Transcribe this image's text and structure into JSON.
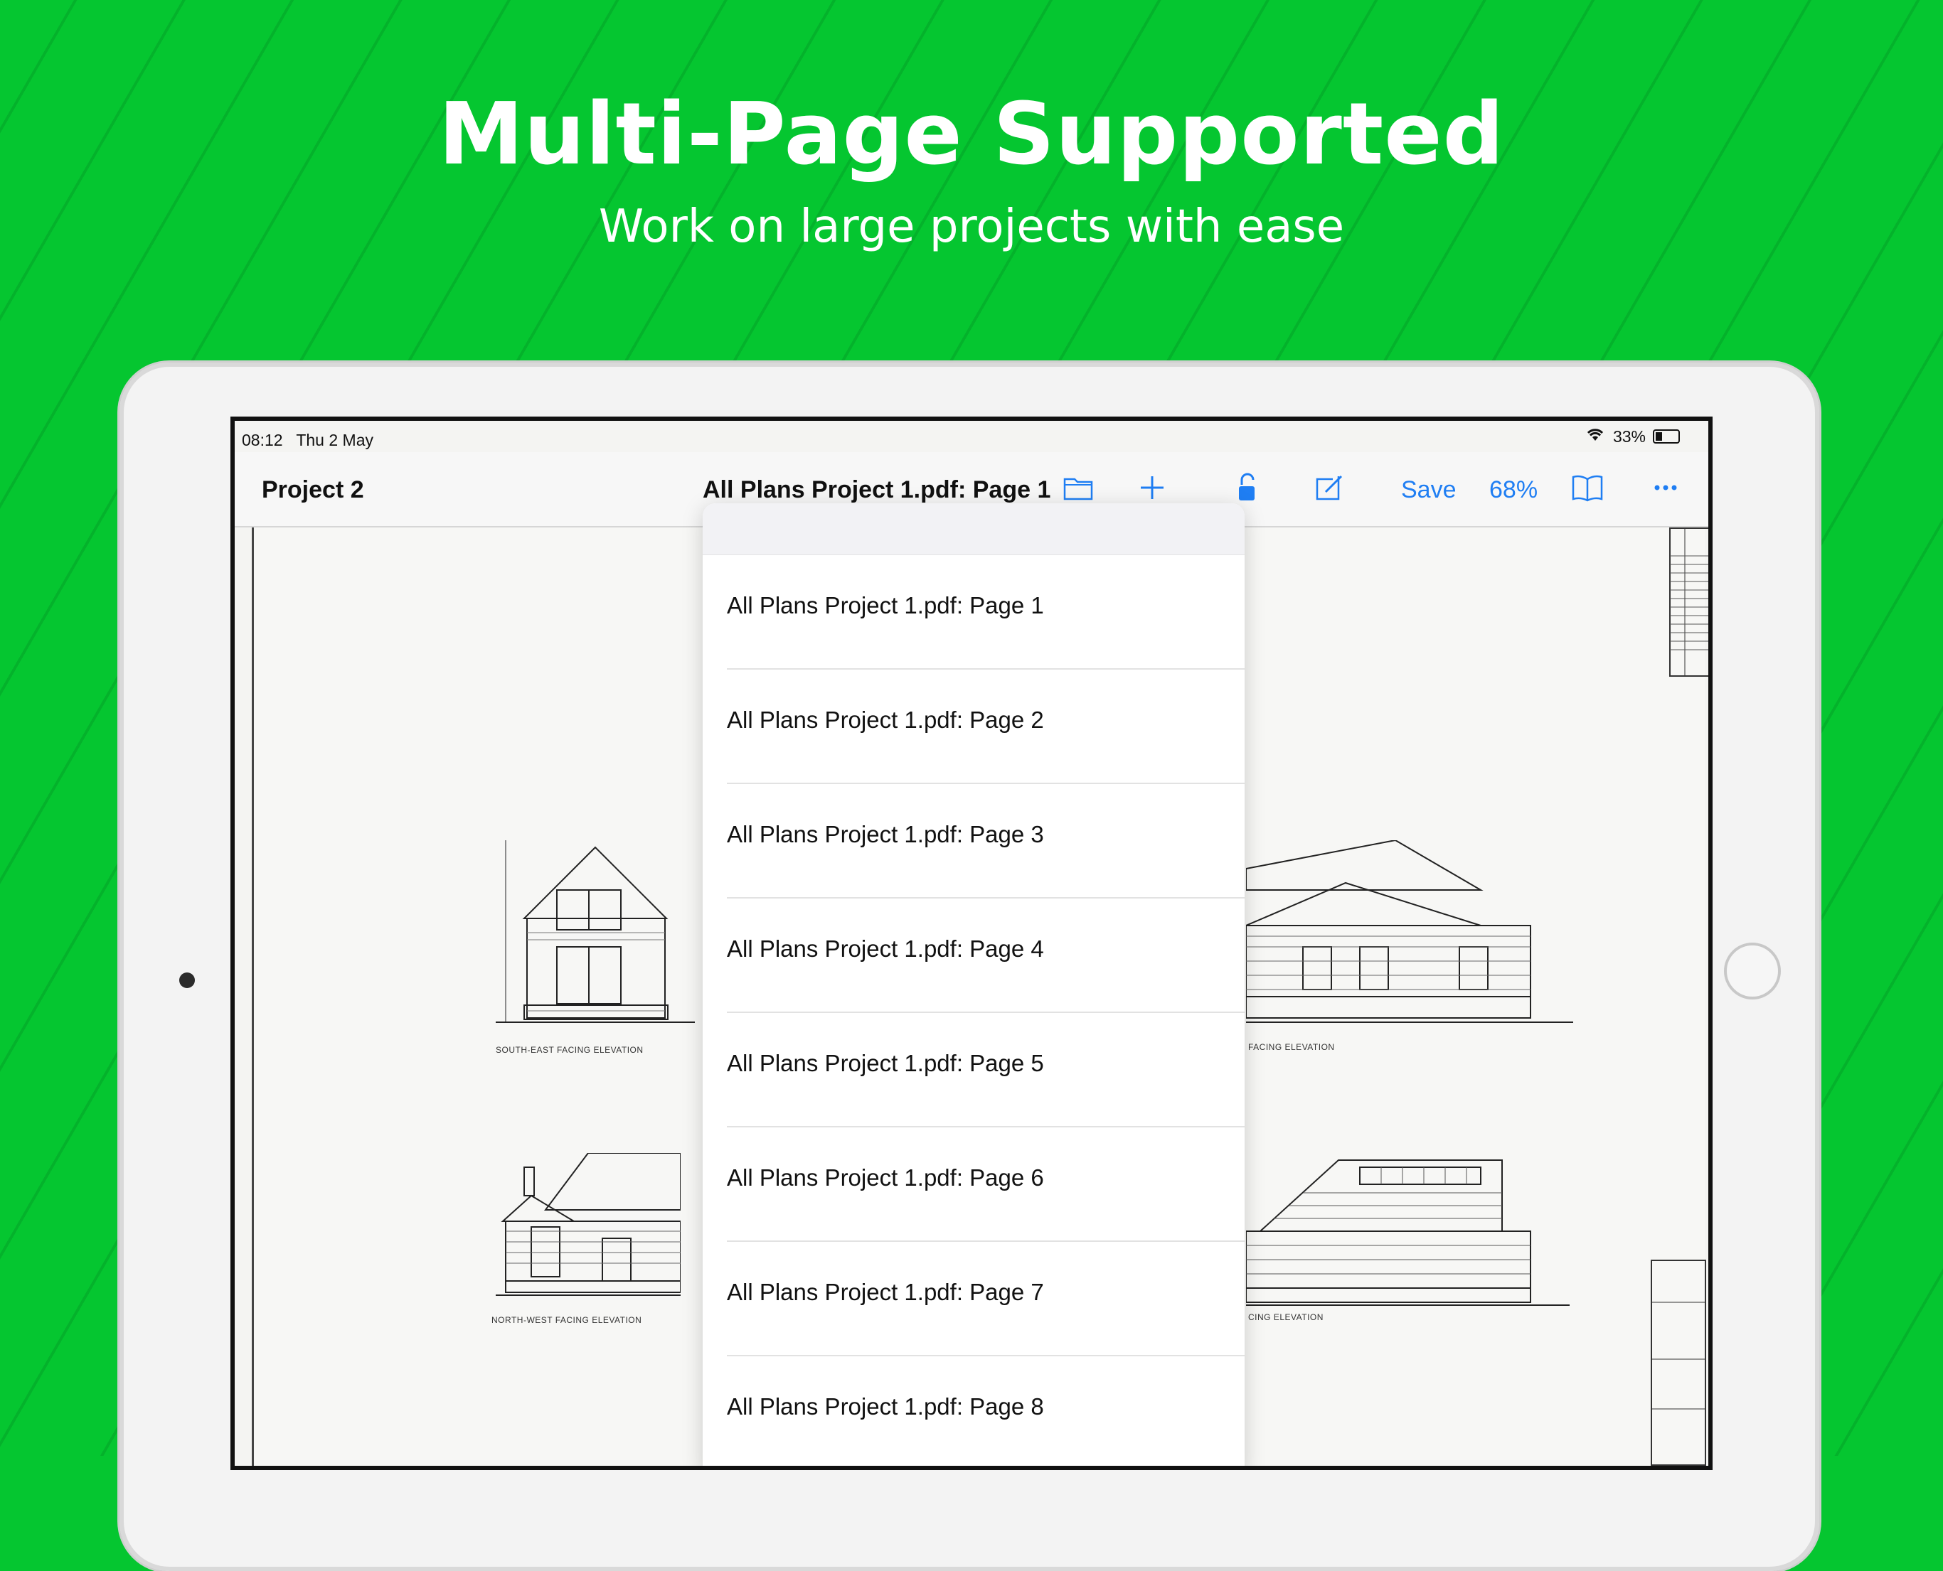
{
  "headline": "Multi-Page Supported",
  "subheadline": "Work on large projects with ease",
  "status": {
    "time": "08:12",
    "date": "Thu 2 May",
    "battery": "33%"
  },
  "navbar": {
    "project_label": "Project 2",
    "document_title": "All Plans Project 1.pdf: Page 1",
    "save_label": "Save",
    "zoom": "68%",
    "icons": [
      "folder-icon",
      "plus-icon",
      "unlock-icon",
      "compose-icon",
      "book-icon",
      "more-icon"
    ]
  },
  "drawings": {
    "labels": [
      "SOUTH-EAST FACING ELEVATION",
      "FACING ELEVATION",
      "NORTH-WEST FACING ELEVATION",
      "CING ELEVATION"
    ]
  },
  "page_menu": {
    "items": [
      "All Plans Project 1.pdf: Page 1",
      "All Plans Project 1.pdf: Page 2",
      "All Plans Project 1.pdf: Page 3",
      "All Plans Project 1.pdf: Page 4",
      "All Plans Project 1.pdf: Page 5",
      "All Plans Project 1.pdf: Page 6",
      "All Plans Project 1.pdf: Page 7",
      "All Plans Project 1.pdf: Page 8"
    ]
  },
  "colors": {
    "background": "#05c630",
    "accent": "#1f7ef3"
  }
}
